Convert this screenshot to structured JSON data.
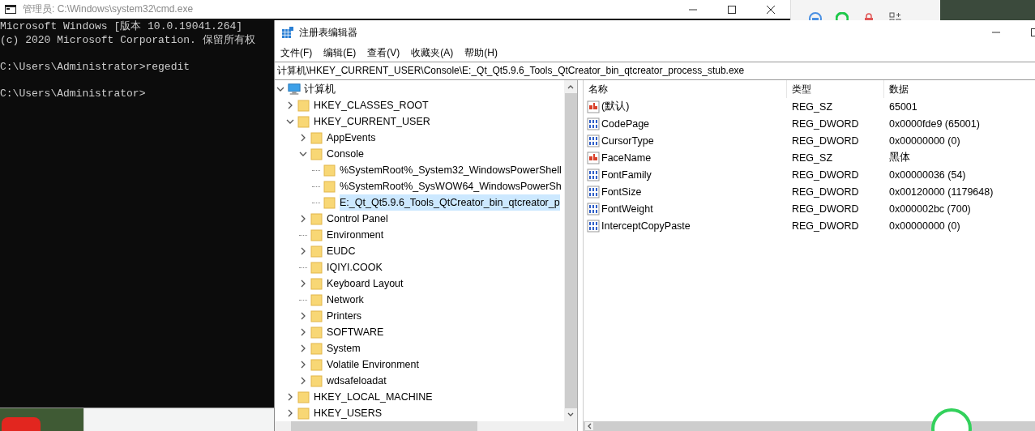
{
  "cmd": {
    "title": "管理员: C:\\Windows\\system32\\cmd.exe",
    "blocks": [
      [
        "Microsoft Windows [版本 10.0.19041.264]",
        "(c) 2020 Microsoft Corporation. 保留所有权"
      ],
      [
        "C:\\Users\\Administrator>regedit"
      ],
      [
        "C:\\Users\\Administrator>"
      ]
    ]
  },
  "regedit": {
    "title": "注册表编辑器",
    "menu": [
      "文件(F)",
      "编辑(E)",
      "查看(V)",
      "收藏夹(A)",
      "帮助(H)"
    ],
    "address": "计算机\\HKEY_CURRENT_USER\\Console\\E:_Qt_Qt5.9.6_Tools_QtCreator_bin_qtcreator_process_stub.exe",
    "tree": {
      "label": "计算机",
      "expandable": true,
      "expanded": true,
      "selected": false,
      "children": [
        {
          "label": "HKEY_CLASSES_ROOT",
          "expandable": true,
          "expanded": false,
          "selected": false
        },
        {
          "label": "HKEY_CURRENT_USER",
          "expandable": true,
          "expanded": true,
          "selected": false,
          "children": [
            {
              "label": "AppEvents",
              "expandable": true,
              "expanded": false,
              "selected": false
            },
            {
              "label": "Console",
              "expandable": true,
              "expanded": true,
              "selected": false,
              "children": [
                {
                  "label": "%SystemRoot%_System32_WindowsPowerShell",
                  "expandable": false,
                  "selected": false
                },
                {
                  "label": "%SystemRoot%_SysWOW64_WindowsPowerSh",
                  "expandable": false,
                  "selected": false
                },
                {
                  "label": "E:_Qt_Qt5.9.6_Tools_QtCreator_bin_qtcreator_p",
                  "expandable": false,
                  "selected": true
                }
              ]
            },
            {
              "label": "Control Panel",
              "expandable": true,
              "expanded": false,
              "selected": false
            },
            {
              "label": "Environment",
              "expandable": false,
              "selected": false
            },
            {
              "label": "EUDC",
              "expandable": true,
              "expanded": false,
              "selected": false
            },
            {
              "label": "IQIYI.COOK",
              "expandable": false,
              "selected": false
            },
            {
              "label": "Keyboard Layout",
              "expandable": true,
              "expanded": false,
              "selected": false
            },
            {
              "label": "Network",
              "expandable": false,
              "selected": false
            },
            {
              "label": "Printers",
              "expandable": true,
              "expanded": false,
              "selected": false
            },
            {
              "label": "SOFTWARE",
              "expandable": true,
              "expanded": false,
              "selected": false
            },
            {
              "label": "System",
              "expandable": true,
              "expanded": false,
              "selected": false
            },
            {
              "label": "Volatile Environment",
              "expandable": true,
              "expanded": false,
              "selected": false
            },
            {
              "label": "wdsafeloadat",
              "expandable": true,
              "expanded": false,
              "selected": false
            }
          ]
        },
        {
          "label": "HKEY_LOCAL_MACHINE",
          "expandable": true,
          "expanded": false,
          "selected": false
        },
        {
          "label": "HKEY_USERS",
          "expandable": true,
          "expanded": false,
          "selected": false
        }
      ]
    },
    "columns": [
      "名称",
      "类型",
      "数据"
    ],
    "rows": [
      {
        "kind": "string",
        "name": "(默认)",
        "type": "REG_SZ",
        "data": "65001"
      },
      {
        "kind": "binary",
        "name": "CodePage",
        "type": "REG_DWORD",
        "data": "0x0000fde9 (65001)"
      },
      {
        "kind": "binary",
        "name": "CursorType",
        "type": "REG_DWORD",
        "data": "0x00000000 (0)"
      },
      {
        "kind": "string",
        "name": "FaceName",
        "type": "REG_SZ",
        "data": "黑体"
      },
      {
        "kind": "binary",
        "name": "FontFamily",
        "type": "REG_DWORD",
        "data": "0x00000036 (54)"
      },
      {
        "kind": "binary",
        "name": "FontSize",
        "type": "REG_DWORD",
        "data": "0x00120000 (1179648)"
      },
      {
        "kind": "binary",
        "name": "FontWeight",
        "type": "REG_DWORD",
        "data": "0x000002bc (700)"
      },
      {
        "kind": "binary",
        "name": "InterceptCopyPaste",
        "type": "REG_DWORD",
        "data": "0x00000000 (0)"
      }
    ]
  }
}
